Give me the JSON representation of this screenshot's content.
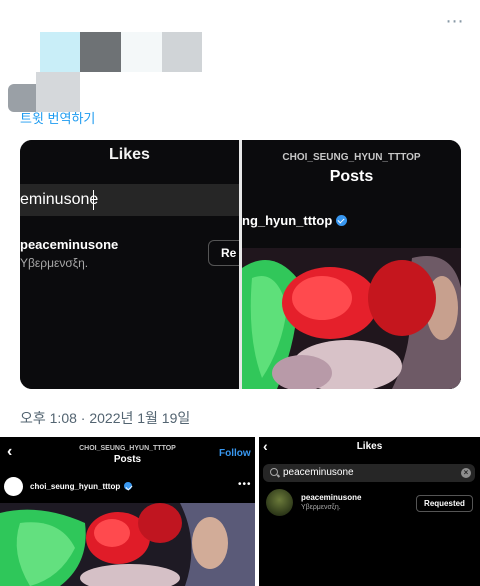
{
  "tweet": {
    "translate_link": "트윗 번역하기",
    "timestamp": "오후 1:08 · 2022년 1월 19일"
  },
  "embed": {
    "left": {
      "title": "Likes",
      "search_value": "eminusone",
      "user_name": "peaceminusone",
      "user_sub": "Υβερμενσξη.",
      "button_label": "Re"
    },
    "right": {
      "account": "CHOI_SEUNG_HYUN_TTTOP",
      "title": "Posts",
      "username": "ng_hyun_tttop"
    }
  },
  "bottom_left": {
    "account": "CHOI_SEUNG_HYUN_TTTOP",
    "title": "Posts",
    "follow_label": "Follow",
    "username": "choi_seung_hyun_tttop"
  },
  "bottom_right": {
    "title": "Likes",
    "search_value": "peaceminusone",
    "user_name": "peaceminusone",
    "user_sub": "Υβερμενσξη.",
    "button_label": "Requested"
  },
  "icons": {
    "more": "more-dots-icon",
    "back": "back-arrow-icon",
    "verified": "verified-badge-icon",
    "search": "search-icon",
    "clear": "clear-icon"
  },
  "colors": {
    "link": "#1d9bf0",
    "instagram_blue": "#3897f0",
    "timestamp": "#536471"
  }
}
